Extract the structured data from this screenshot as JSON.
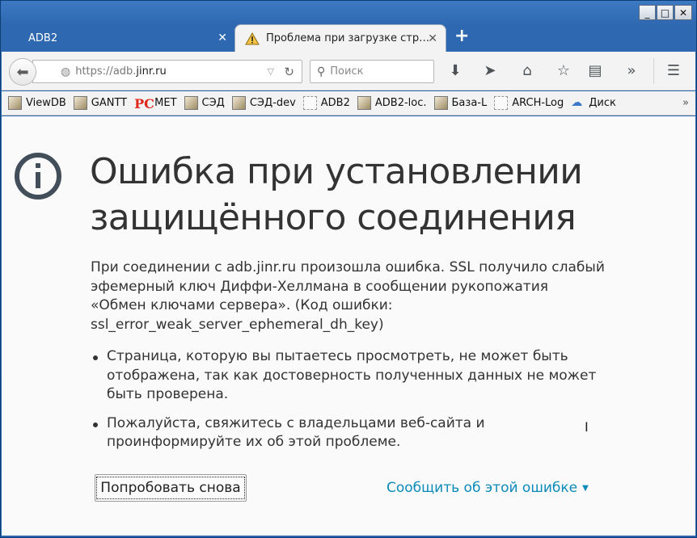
{
  "window": {
    "caption": {
      "minimize": "_",
      "maximize": "□",
      "close": "✕"
    }
  },
  "tabs": [
    {
      "label": "ADB2",
      "active": false,
      "close": "✕"
    },
    {
      "label": "Проблема при загрузке стр…",
      "active": true,
      "icon": "warning-icon",
      "close": "✕"
    }
  ],
  "new_tab_label": "+",
  "navbar": {
    "url_prefix": "https://adb.",
    "url_host": "jinr.ru",
    "search_placeholder": "Поиск",
    "icons": [
      "download-icon",
      "send-icon",
      "home-icon",
      "bookmark-star-icon",
      "reader-icon",
      "overflow-icon",
      "menu-icon"
    ]
  },
  "bookmarks": [
    {
      "label": "ViewDB",
      "icon": "picture"
    },
    {
      "label": "GANTT",
      "icon": "picture"
    },
    {
      "label": "МЕТ",
      "icon": "pc"
    },
    {
      "label": "СЭД",
      "icon": "picture"
    },
    {
      "label": "СЭД-dev",
      "icon": "picture"
    },
    {
      "label": "ADB2",
      "icon": "dashed"
    },
    {
      "label": "ADB2-loc.",
      "icon": "picture"
    },
    {
      "label": "База-L",
      "icon": "picture"
    },
    {
      "label": "ARCH-Log",
      "icon": "dashed"
    },
    {
      "label": "Диск",
      "icon": "disk"
    }
  ],
  "bookmarks_more": "»",
  "error": {
    "title": "Ошибка при установлении защищённого соединения",
    "description": "При соединении с adb.jinr.ru произошла ошибка. SSL получило слабый эфемерный ключ Диффи-Хеллмана в сообщении рукопожатия «Обмен ключами сервера». (Код ошибки: ssl_error_weak_server_ephemeral_dh_key)",
    "bullets": [
      "Страница, которую вы пытаетесь просмотреть, не может быть отображена, так как достоверность полученных данных не может быть проверена.",
      "Пожалуйста, свяжитесь с владельцами веб-сайта и проинформируйте их об этой проблеме."
    ],
    "retry_button": "Попробовать снова",
    "report_link": "Сообщить об этой ошибке"
  },
  "colors": {
    "titlebar": "#2e68b0",
    "link": "#0a8ab8",
    "text": "#333333",
    "info_icon": "#424f5a"
  }
}
